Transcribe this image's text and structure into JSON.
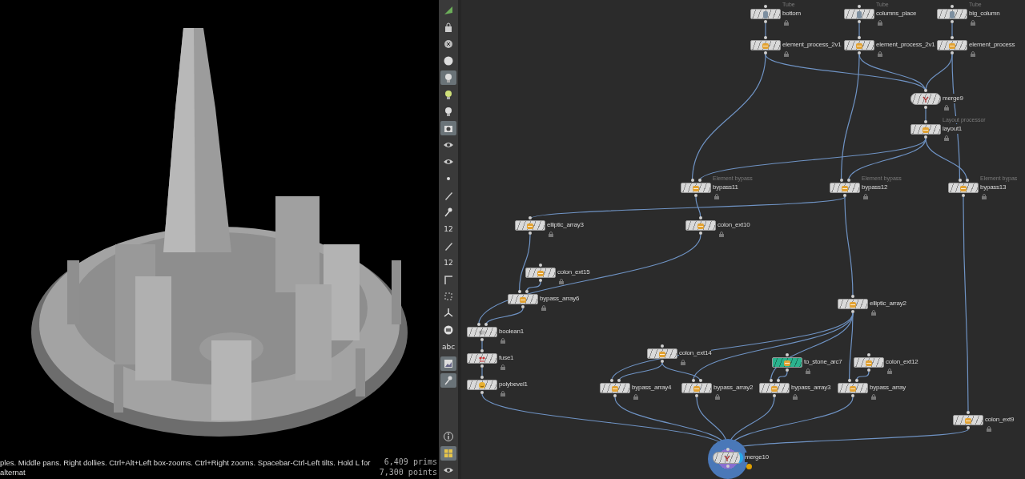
{
  "viewport": {
    "hint": "ples. Middle pans. Right dollies. Ctrl+Alt+Left box-zooms. Ctrl+Right zooms. Spacebar-Ctrl-Left tilts. Hold L for alternat",
    "stats": [
      "6,409 prims",
      "7,300 points"
    ]
  },
  "toolbar": {
    "top": [
      {
        "kind": "icon",
        "selected": false
      },
      {
        "kind": "icon",
        "selected": false
      },
      {
        "kind": "icon",
        "selected": false
      },
      {
        "kind": "icon",
        "selected": false
      },
      {
        "kind": "icon",
        "selected": true
      },
      {
        "kind": "icon",
        "selected": false
      },
      {
        "kind": "icon",
        "selected": false
      },
      {
        "kind": "icon",
        "selected": true
      },
      {
        "kind": "icon",
        "selected": false
      },
      {
        "kind": "icon",
        "selected": false
      },
      {
        "kind": "icon",
        "selected": false
      },
      {
        "kind": "icon",
        "selected": false
      },
      {
        "kind": "icon",
        "selected": false
      },
      {
        "kind": "text",
        "label": "12",
        "selected": false
      },
      {
        "kind": "icon",
        "selected": false
      },
      {
        "kind": "text",
        "label": "12",
        "selected": false
      },
      {
        "kind": "icon",
        "selected": false
      },
      {
        "kind": "icon",
        "selected": false
      },
      {
        "kind": "icon",
        "selected": false
      },
      {
        "kind": "icon",
        "selected": false
      },
      {
        "kind": "text",
        "label": "abc",
        "selected": false
      },
      {
        "kind": "icon",
        "selected": true
      },
      {
        "kind": "icon",
        "selected": true
      }
    ],
    "bottom": [
      {
        "kind": "icon",
        "selected": false
      },
      {
        "kind": "icon",
        "selected": true
      },
      {
        "kind": "icon",
        "selected": false
      }
    ]
  },
  "network": {
    "nodes": [
      {
        "name": "bottom",
        "comment": "Tube",
        "kind": "tube",
        "color": "#d9d9d9",
        "display_flag": false,
        "warning": false
      },
      {
        "name": "columns_place",
        "comment": "Tube",
        "kind": "tube",
        "color": "#d9d9d9",
        "display_flag": false,
        "warning": false
      },
      {
        "name": "big_column",
        "comment": "Tube",
        "kind": "tube",
        "color": "#d9d9d9",
        "display_flag": false,
        "warning": false
      },
      {
        "name": "element_process_2v1",
        "kind": "asset",
        "color": "#d9d9d9",
        "display_flag": false,
        "warning": false
      },
      {
        "name": "element_process_2v1",
        "kind": "asset",
        "color": "#d9d9d9",
        "display_flag": false,
        "warning": false
      },
      {
        "name": "element_process",
        "kind": "asset",
        "color": "#d9d9d9",
        "display_flag": false,
        "warning": false
      },
      {
        "name": "merge9",
        "kind": "merge",
        "color": "#d9d9d9",
        "display_flag": false,
        "warning": false
      },
      {
        "name": "layout1",
        "comment": "Layout processor",
        "kind": "asset",
        "color": "#d9d9d9",
        "display_flag": false,
        "warning": false
      },
      {
        "name": "bypass11",
        "comment": "Element bypass",
        "kind": "asset",
        "color": "#d9d9d9",
        "display_flag": false,
        "warning": false
      },
      {
        "name": "bypass12",
        "comment": "Element bypass",
        "kind": "asset",
        "color": "#d9d9d9",
        "display_flag": false,
        "warning": false
      },
      {
        "name": "bypass13",
        "comment": "Element bypas",
        "kind": "asset",
        "color": "#d9d9d9",
        "display_flag": false,
        "warning": false
      },
      {
        "name": "elliptic_array3",
        "kind": "asset",
        "color": "#d9d9d9",
        "display_flag": false,
        "warning": false
      },
      {
        "name": "colon_ext10",
        "kind": "asset",
        "color": "#d9d9d9",
        "display_flag": false,
        "warning": false
      },
      {
        "name": "colon_ext15",
        "kind": "asset",
        "color": "#d9d9d9",
        "display_flag": false,
        "warning": false
      },
      {
        "name": "bypass_array6",
        "kind": "asset",
        "color": "#d9d9d9",
        "display_flag": false,
        "warning": false
      },
      {
        "name": "elliptic_array2",
        "kind": "asset",
        "color": "#d9d9d9",
        "display_flag": false,
        "warning": false
      },
      {
        "name": "boolean1",
        "kind": "boolean",
        "color": "#d9d9d9",
        "display_flag": false,
        "warning": false
      },
      {
        "name": "fuse1",
        "kind": "fuse",
        "color": "#d9d9d9",
        "display_flag": false,
        "warning": false
      },
      {
        "name": "polybevel1",
        "kind": "bevel",
        "color": "#d9d9d9",
        "display_flag": false,
        "warning": false
      },
      {
        "name": "colon_ext14",
        "kind": "asset",
        "color": "#d9d9d9",
        "display_flag": false,
        "warning": false
      },
      {
        "name": "to_stone_arc7",
        "kind": "asset",
        "color": "#2bb38e",
        "display_flag": false,
        "warning": false
      },
      {
        "name": "colon_ext12",
        "kind": "asset",
        "color": "#d9d9d9",
        "display_flag": false,
        "warning": false
      },
      {
        "name": "bypass_array4",
        "kind": "asset",
        "color": "#d9d9d9",
        "display_flag": false,
        "warning": false
      },
      {
        "name": "bypass_array2",
        "kind": "asset",
        "color": "#d9d9d9",
        "display_flag": false,
        "warning": false
      },
      {
        "name": "bypass_array3",
        "kind": "asset",
        "color": "#d9d9d9",
        "display_flag": false,
        "warning": false
      },
      {
        "name": "bypass_array",
        "kind": "asset",
        "color": "#d9d9d9",
        "display_flag": false,
        "warning": false
      },
      {
        "name": "colon_ext9",
        "kind": "asset",
        "color": "#d9d9d9",
        "display_flag": false,
        "warning": false
      },
      {
        "name": "merge10",
        "kind": "merge",
        "color": "#d9d9d9",
        "display_flag": true,
        "warning": true
      }
    ]
  }
}
